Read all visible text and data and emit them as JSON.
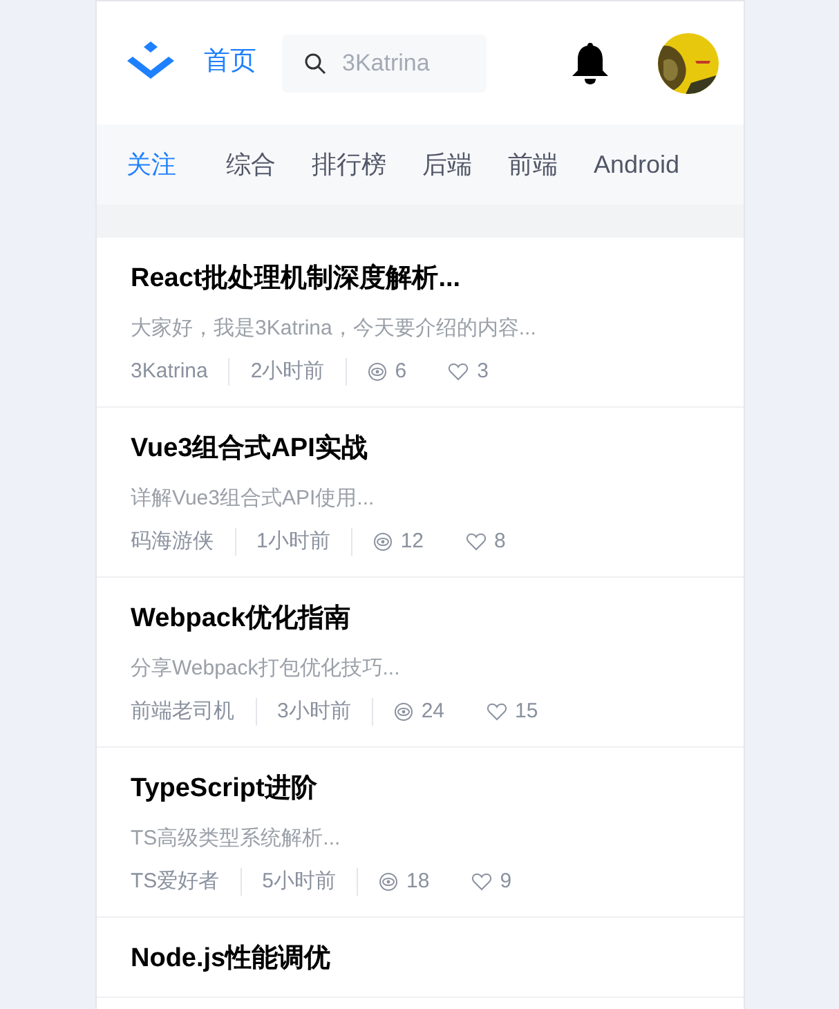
{
  "header": {
    "home_link": "首页",
    "search": {
      "placeholder": "3Katrina"
    }
  },
  "tabs": [
    {
      "label": "关注",
      "selected": true
    },
    {
      "label": "综合",
      "selected": false
    },
    {
      "label": "排行榜",
      "selected": false
    },
    {
      "label": "后端",
      "selected": false
    },
    {
      "label": "前端",
      "selected": false
    },
    {
      "label": "Android",
      "selected": false
    }
  ],
  "articles": [
    {
      "title": "React批处理机制深度解析...",
      "summary": "大家好，我是3Katrina，今天要介绍的内容...",
      "author": "3Katrina",
      "time": "2小时前",
      "views": "6",
      "likes": "3"
    },
    {
      "title": "Vue3组合式API实战",
      "summary": "详解Vue3组合式API使用...",
      "author": "码海游侠",
      "time": "1小时前",
      "views": "12",
      "likes": "8"
    },
    {
      "title": "Webpack优化指南",
      "summary": "分享Webpack打包优化技巧...",
      "author": "前端老司机",
      "time": "3小时前",
      "views": "24",
      "likes": "15"
    },
    {
      "title": "TypeScript进阶",
      "summary": "TS高级类型系统解析...",
      "author": "TS爱好者",
      "time": "5小时前",
      "views": "18",
      "likes": "9"
    },
    {
      "title": "Node.js性能调优"
    }
  ]
}
